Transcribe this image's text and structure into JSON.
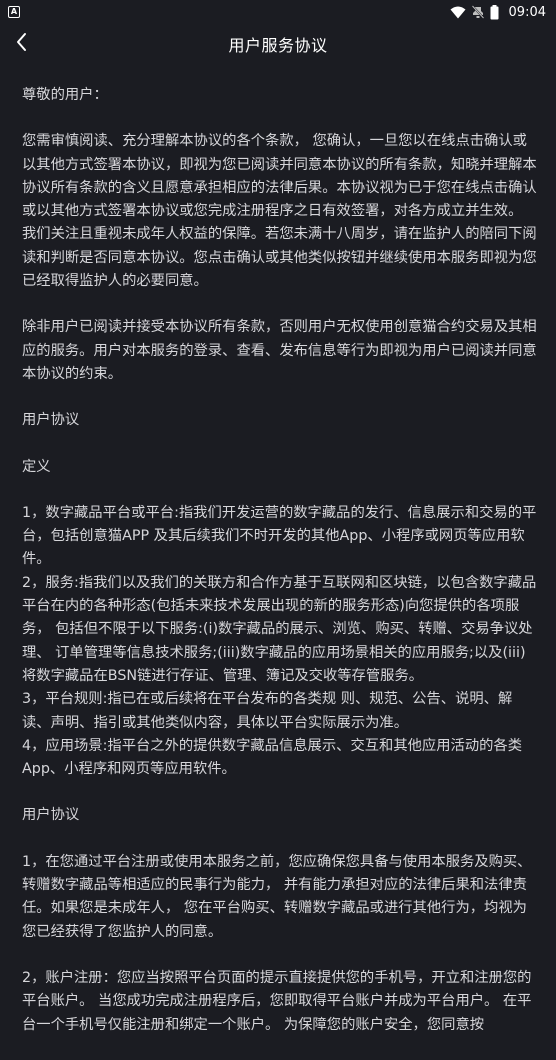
{
  "status_bar": {
    "badge": "A",
    "time": "09:04",
    "icons": [
      "wifi-icon",
      "mute-icon",
      "battery-icon"
    ]
  },
  "header": {
    "title": "用户服务协议",
    "back_icon": "chevron-left-icon"
  },
  "body": {
    "greeting": "尊敬的用户：",
    "intro1": "您需审慎阅读、充分理解本协议的各个条款， 您确认，一旦您以在线点击确认或以其他方式签署本协议，即视为您已阅读并同意本协议的所有条款，知晓并理解本协议所有条款的含义且愿意承担相应的法律后果。本协议视为已于您在线点击确认或以其他方式签署本协议或您完成注册程序之日有效签署，对各方成立并生效。 我们关注且重视未成年人权益的保障。若您未满十八周岁，请在监护人的陪同下阅读和判断是否同意本协议。您点击确认或其他类似按钮并继续使用本服务即视为您已经取得监护人的必要同意。",
    "intro2": "除非用户已阅读并接受本协议所有条款，否则用户无权使用创意猫合约交易及其相应的服务。用户对本服务的登录、查看、发布信息等行为即视为用户已阅读并同意本协议的约束。",
    "section1_title": "用户协议",
    "definitions_title": "定义",
    "def1": "1，数字藏品平台或平台:指我们开发运营的数字藏品的发行、信息展示和交易的平台，包括创意猫APP 及其后续我们不时开发的其他App、小程序或网页等应用软件。",
    "def2": "2，服务:指我们以及我们的关联方和合作方基于互联网和区块链，以包含数字藏品平台在内的各种形态(包括未来技术发展出现的新的服务形态)向您提供的各项服务， 包括但不限于以下服务:(i)数字藏品的展示、浏览、购买、转赠、交易争议处理、 订单管理等信息技术服务;(iii)数字藏品的应用场景相关的应用服务;以及(iii)将数字藏品在BSN链进行存证、管理、簿记及交收等存管服务。",
    "def3": "3，平台规则:指已在或后续将在平台发布的各类规 则、规范、公告、说明、解读、声明、指引或其他类似内容，具体以平台实际展示为准。",
    "def4": "4，应用场景:指平台之外的提供数字藏品信息展示、交互和其他应用活动的各类App、小程序和网页等应用软件。",
    "section2_title": "用户协议",
    "term1": "1，在您通过平台注册或使用本服务之前，您应确保您具备与使用本服务及购买、转赠数字藏品等相适应的民事行为能力， 并有能力承担对应的法律后果和法律责任。如果您是未成年人， 您在平台购买、转赠数字藏品或进行其他行为，均视为您已经获得了您监护人的同意。",
    "term2": "2，账户注册：您应当按照平台页面的提示直接提供您的手机号，开立和注册您的平台账户。 当您成功完成注册程序后，您即取得平台账户并成为平台用户。 在平台一个手机号仅能注册和绑定一个账户。 为保障您的账户安全，您同意按"
  }
}
